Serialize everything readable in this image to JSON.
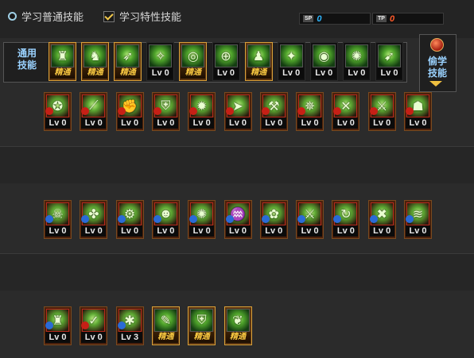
{
  "top": {
    "learn_normal": "学习普通技能",
    "learn_trait": "学习特性技能",
    "sp_left_tag": "SP",
    "sp_left_value": "0",
    "sp_right_tag": "TP",
    "sp_right_value": "0",
    "sp_left_color": "#2fb7ff",
    "sp_right_color": "#ff5a2a"
  },
  "common": {
    "label_line1": "通用",
    "label_line2": "技能"
  },
  "side": {
    "label_line1": "偷学",
    "label_line2": "技能"
  },
  "common_skills": [
    {
      "icon": "person-sit-icon",
      "level": "精通",
      "mastered": true
    },
    {
      "icon": "running-icon",
      "level": "精通",
      "mastered": true
    },
    {
      "icon": "sprint-icon",
      "level": "精通",
      "mastered": true
    },
    {
      "icon": "wings-icon",
      "level": "Lv 0",
      "mastered": false
    },
    {
      "icon": "target-icon",
      "level": "精通",
      "mastered": true
    },
    {
      "icon": "crosshair-icon",
      "level": "Lv 0",
      "mastered": false
    },
    {
      "icon": "bust-icon",
      "level": "精通",
      "mastered": true
    },
    {
      "icon": "strike-icon",
      "level": "Lv 0",
      "mastered": false
    },
    {
      "icon": "eye-icon",
      "level": "Lv 0",
      "mastered": false
    },
    {
      "icon": "shine-figure-icon",
      "level": "Lv 0",
      "mastered": false
    },
    {
      "icon": "leap-icon",
      "level": "Lv 0",
      "mastered": false
    }
  ],
  "row1": [
    {
      "icon": "kick-icon",
      "level": "Lv 0"
    },
    {
      "icon": "slash-icon",
      "level": "Lv 0"
    },
    {
      "icon": "fist-icon",
      "level": "Lv 0"
    },
    {
      "icon": "shield-icon",
      "level": "Lv 0"
    },
    {
      "icon": "burst-icon",
      "level": "Lv 0"
    },
    {
      "icon": "dash-icon",
      "level": "Lv 0"
    },
    {
      "icon": "hammer-icon",
      "level": "Lv 0"
    },
    {
      "icon": "flame-icon",
      "level": "Lv 0"
    },
    {
      "icon": "cross-blade-icon",
      "level": "Lv 0"
    },
    {
      "icon": "blade-icon",
      "level": "Lv 0"
    },
    {
      "icon": "climb-icon",
      "level": "Lv 0"
    }
  ],
  "row2": [
    {
      "icon": "skull-icon",
      "level": "Lv 0"
    },
    {
      "icon": "beast-icon",
      "level": "Lv 0"
    },
    {
      "icon": "gear-fist-icon",
      "level": "Lv 0"
    },
    {
      "icon": "mask-icon",
      "level": "Lv 0"
    },
    {
      "icon": "swirl-icon",
      "level": "Lv 0"
    },
    {
      "icon": "jaws-icon",
      "level": "Lv 0"
    },
    {
      "icon": "spirit-icon",
      "level": "Lv 0"
    },
    {
      "icon": "sword-icon",
      "level": "Lv 0"
    },
    {
      "icon": "hook-icon",
      "level": "Lv 0"
    },
    {
      "icon": "x-burst-icon",
      "level": "Lv 0"
    },
    {
      "icon": "wave-icon",
      "level": "Lv 0"
    }
  ],
  "row3": [
    {
      "icon": "guardian-icon",
      "level": "Lv 0",
      "mastered": false
    },
    {
      "icon": "claw-icon",
      "level": "Lv 0",
      "mastered": false
    },
    {
      "icon": "orb-icon",
      "level": "Lv 3",
      "mastered": false
    },
    {
      "icon": "scroll-icon",
      "level": "精通",
      "mastered": true
    },
    {
      "icon": "armor-icon",
      "level": "精通",
      "mastered": true
    },
    {
      "icon": "feather-icon",
      "level": "精通",
      "mastered": true
    }
  ]
}
